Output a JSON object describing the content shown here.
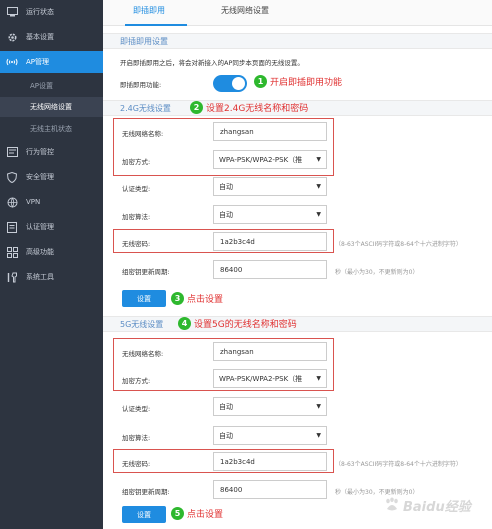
{
  "sidebar": {
    "items": [
      {
        "label": "运行状态",
        "icon": "monitor-icon"
      },
      {
        "label": "基本设置",
        "icon": "gear-icon"
      },
      {
        "label": "AP管理",
        "icon": "wireless-ap-icon"
      },
      {
        "label": "AP设置",
        "icon": ""
      },
      {
        "label": "无线网络设置",
        "icon": ""
      },
      {
        "label": "无线主机状态",
        "icon": ""
      },
      {
        "label": "行为管控",
        "icon": "behavior-icon"
      },
      {
        "label": "安全管理",
        "icon": "shield-icon"
      },
      {
        "label": "VPN",
        "icon": "vpn-icon"
      },
      {
        "label": "认证管理",
        "icon": "auth-icon"
      },
      {
        "label": "高级功能",
        "icon": "grid-icon"
      },
      {
        "label": "系统工具",
        "icon": "tools-icon"
      }
    ]
  },
  "tabs": [
    {
      "label": "即插即用"
    },
    {
      "label": "无线网络设置"
    }
  ],
  "plug": {
    "header": "即插即用设置",
    "desc": "开启即插即用之后，将会对新接入的AP同步本页面的无线设置。",
    "toggle_label": "即插即用功能:",
    "toggle_state": "on"
  },
  "band24": {
    "header": "2.4G无线设置",
    "ssid_label": "无线网络名称:",
    "ssid_value": "zhangsan",
    "enc_label": "加密方式:",
    "enc_value": "WPA-PSK/WPA2-PSK（推",
    "auth_label": "认证类型:",
    "auth_value": "自动",
    "algo_label": "加密算法:",
    "algo_value": "自动",
    "pwd_label": "无线密码:",
    "pwd_value": "1a2b3c4d",
    "pwd_hint": "（8-63个ASCII码字符或8-64个十六进制字符）",
    "rekey_label": "组密钥更新周期:",
    "rekey_value": "86400",
    "rekey_hint": "秒（最小为30，不更新则为0）",
    "save_label": "设置"
  },
  "band5": {
    "header": "5G无线设置",
    "ssid_label": "无线网络名称:",
    "ssid_value": "zhangsan",
    "enc_label": "加密方式:",
    "enc_value": "WPA-PSK/WPA2-PSK（推",
    "auth_label": "认证类型:",
    "auth_value": "自动",
    "algo_label": "加密算法:",
    "algo_value": "自动",
    "pwd_label": "无线密码:",
    "pwd_value": "1a2b3c4d",
    "pwd_hint": "（8-63个ASCII码字符或8-64个十六进制字符）",
    "rekey_label": "组密钥更新周期:",
    "rekey_value": "86400",
    "rekey_hint": "秒（最小为30，不更新则为0）",
    "save_label": "设置"
  },
  "annotations": [
    {
      "num": "1",
      "text": "开启即插即用功能"
    },
    {
      "num": "2",
      "text": "设置2.4G无线名称和密码"
    },
    {
      "num": "3",
      "text": "点击设置"
    },
    {
      "num": "4",
      "text": "设置5G的无线名称和密码"
    },
    {
      "num": "5",
      "text": "点击设置"
    }
  ],
  "colors": {
    "accent": "#1f8ce0",
    "sidebar": "#2d3440",
    "annotation_red": "#e03030",
    "annotation_green": "#2eb82e"
  },
  "watermark": {
    "text": "Baidu经验"
  }
}
